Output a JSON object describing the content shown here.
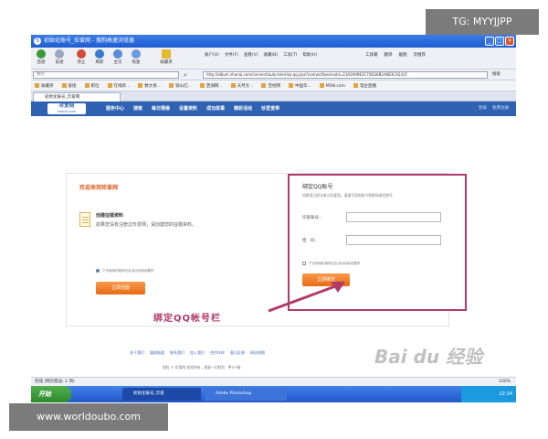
{
  "overlay": {
    "tg": "TG: MYYJJPP",
    "site": "www.worldoubo.com"
  },
  "window": {
    "title": "初始化账号_珍爱网 - 搜狗高速浏览器",
    "url": "http://album.zhenai.com/connect/auto-bind-by-qq.jsps?connectSessionId=23A2A09E3C70D26B2A6B3CA241F"
  },
  "toolbar": {
    "back": "后退",
    "forward": "前进",
    "stop": "停止",
    "refresh": "刷新",
    "home": "主页",
    "restore": "恢复",
    "favorites": "收藏夹",
    "menus": [
      "账户(U)",
      "文件(F)",
      "查看(V)",
      "收藏(B)",
      "工具(T)",
      "帮助(H)"
    ],
    "right": [
      "工具箱",
      "翻译",
      "截图",
      "云推荐"
    ]
  },
  "search": {
    "placeholder": "搜狗"
  },
  "go_label": "搜索",
  "favbar": [
    "收藏夹",
    "链接",
    "职位",
    "在线新...",
    "数文易...",
    "锁山红...",
    "西湖网...",
    "天月文...",
    "百姓网",
    "中国华...",
    "MSN.com",
    "电台直播"
  ],
  "tab": {
    "label": "初始化账号_珍爱网"
  },
  "site": {
    "logo": "珍爱网",
    "logo_sub": "zhenai.com",
    "nav": [
      "服务中心",
      "搜索",
      "每日情缘",
      "设置资料",
      "成功故事",
      "精彩活动",
      "珍爱宽带"
    ],
    "nav_right": [
      "登录",
      "免费注册"
    ]
  },
  "content": {
    "welcome": "欢迎来到珍爱网",
    "create_title": "创建征婚资料",
    "create_desc": "如果您没有注册过珍爱网，请创建您的征婚资料。",
    "remember1": "下次使用珍爱网交友活动功能设置同",
    "create_btn": "立即创建",
    "bind_title": "绑定QQ账号",
    "bind_hint": "如果您已经注册过珍爱网，请填写您的账号和密码绑定账号：",
    "account_label": "珍爱账号：",
    "password_label": "密　码：",
    "remember2": "下次使用珍爱网交友活动功能设置同",
    "bind_btn": "立即绑定",
    "annotation": "绑定QQ帐号栏"
  },
  "footer": {
    "links": [
      "关于我们",
      "媒体报道",
      "联系我们",
      "加入我们",
      "合作伙伴",
      "意见反馈",
      "网站地图"
    ],
    "copyright": "版权 © 珍爱网 版权所有，保留一切权利 · 粤ICP备",
    "watermark": "Bai du 经验"
  },
  "status": {
    "text": "完成 (网页错误: 1 项)",
    "zoom": "100%"
  },
  "taskbar": {
    "start": "开始",
    "task1": "初始化账号_珍爱",
    "task2": "Adobe Photoshop",
    "clock": "22:24"
  },
  "colors": {
    "nav_blue": "#2f62b3",
    "accent_orange": "#e86a14",
    "highlight_magenta": "#b23a6b"
  }
}
